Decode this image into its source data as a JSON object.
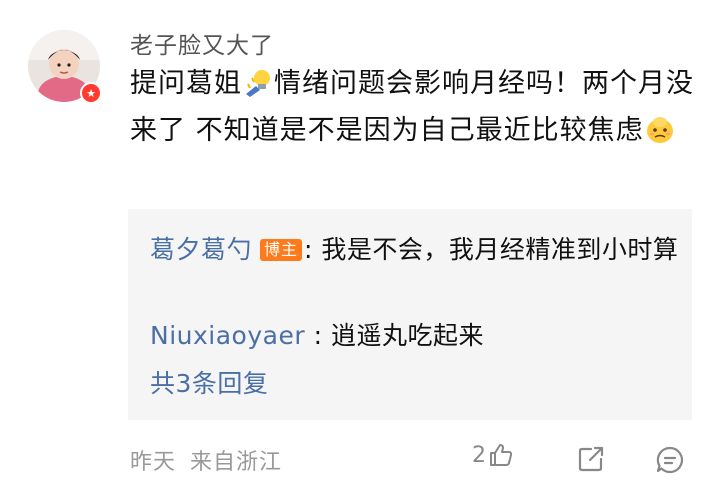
{
  "comment": {
    "username": "老子脸又大了",
    "text_part1": "提问葛姐",
    "text_part2": "情绪问题会影响月经吗！两个月没来了 不知道是不是因为自己最近比较焦虑",
    "emoji_1": "lightbulb-sticker",
    "emoji_2": "worried-face-sticker"
  },
  "replies": [
    {
      "name": "葛夕葛勺",
      "badge": "博主",
      "separator": ":",
      "text": " 我是不会，我月经精准到小时算"
    },
    {
      "name": "Niuxiaoyaer",
      "separator": " :",
      "text": " 逍遥丸吃起来"
    }
  ],
  "more_replies_label": "共3条回复",
  "footer": {
    "time": "昨天",
    "location": "来自浙江",
    "like_count": "2"
  },
  "colors": {
    "link": "#4a6fa5",
    "badge": "#ff7a1a",
    "avatar_badge": "#ff3b30",
    "muted": "#999999"
  }
}
